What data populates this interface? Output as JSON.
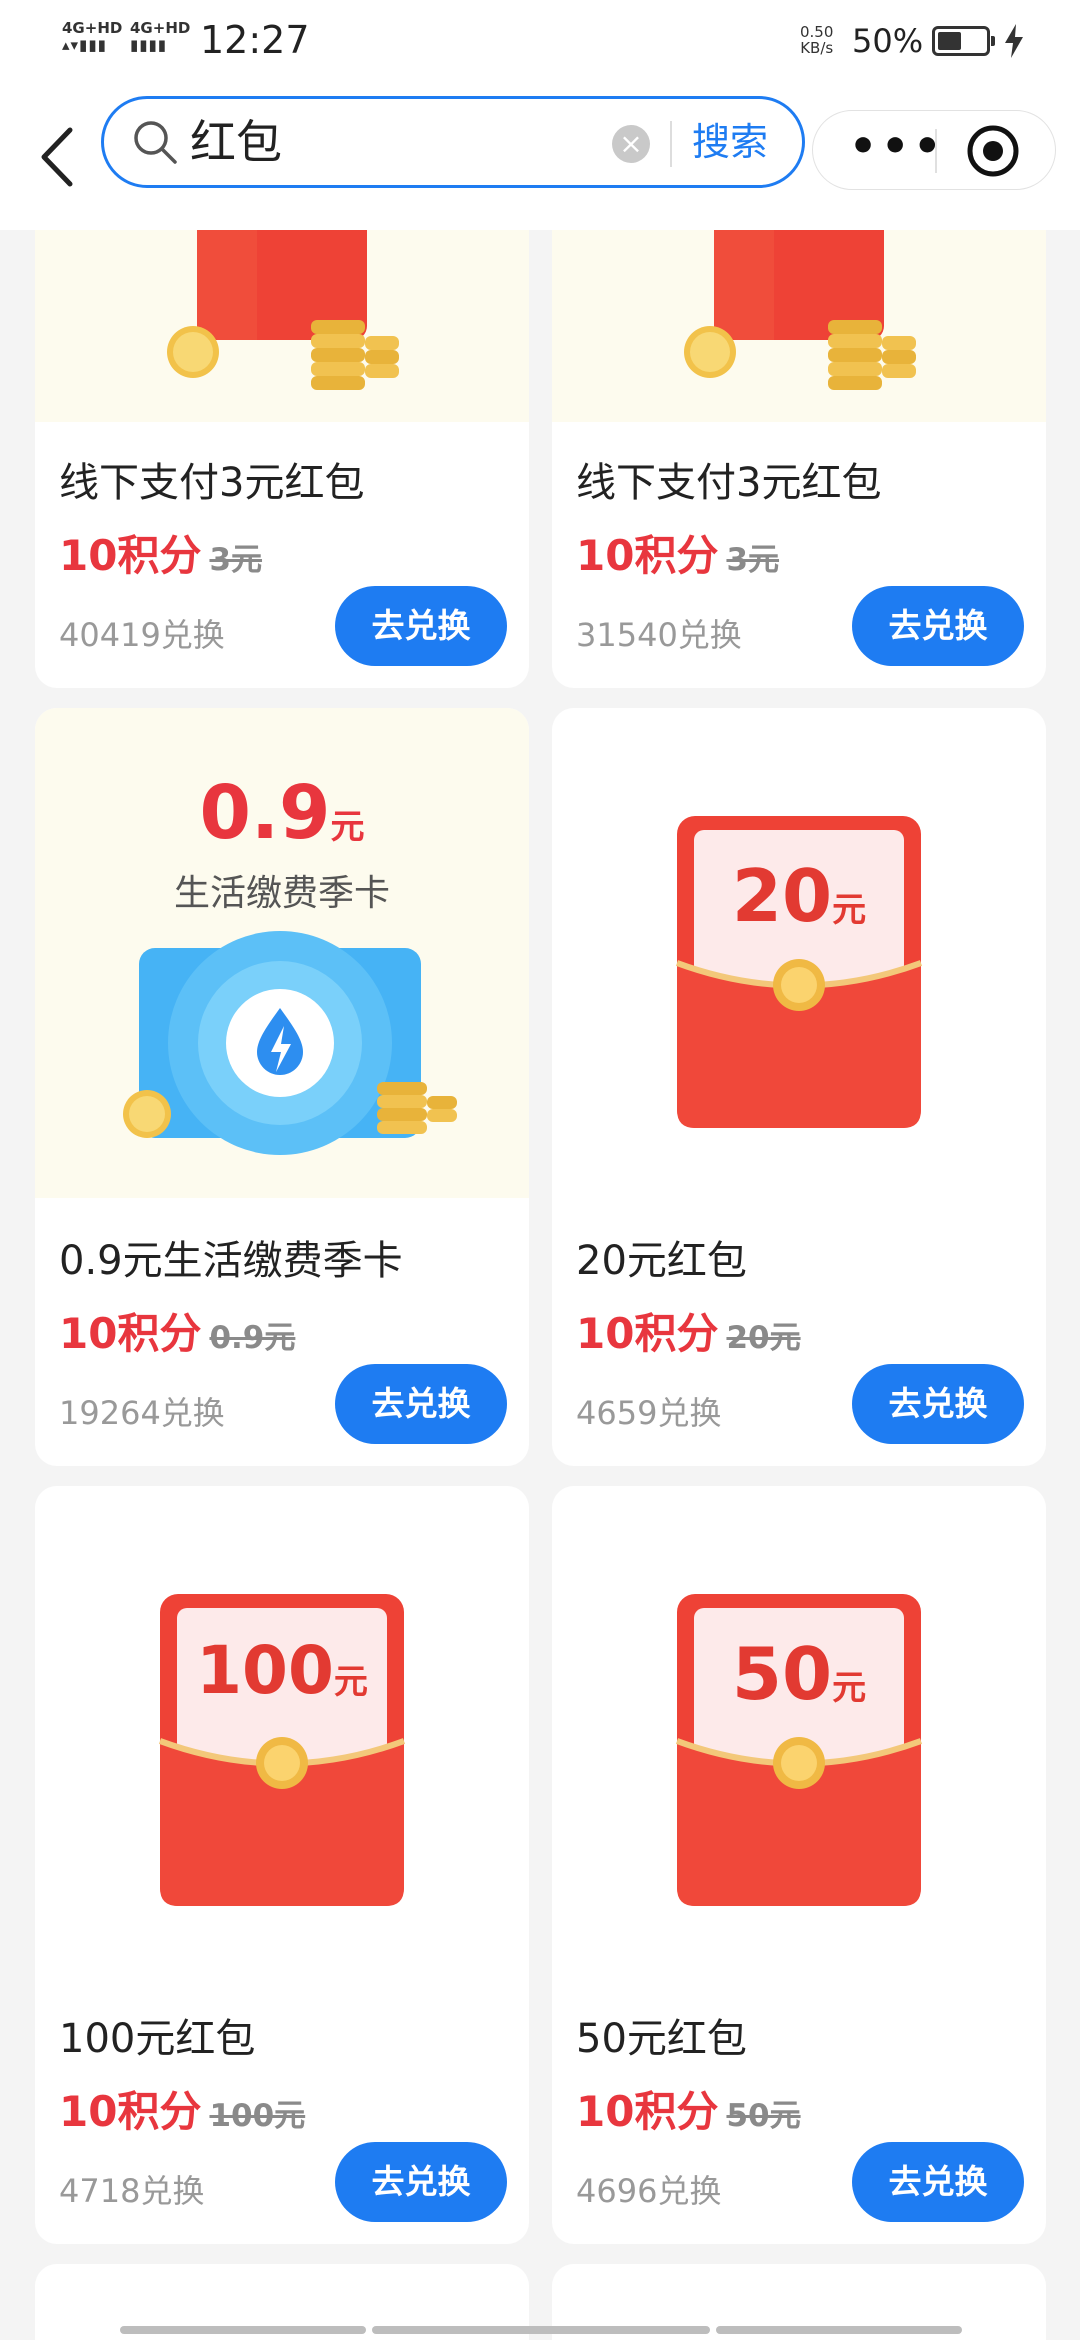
{
  "status": {
    "sig1_label": "4G+HD",
    "sig1_bars": "▴▾▮▮▮",
    "sig2_label": "4G+HD",
    "sig2_bars": "▮▮▮▮",
    "time": "12:27",
    "net_speed": "0.50",
    "net_unit": "KB/s",
    "battery_pct": "50%",
    "battery_level": 0.5
  },
  "header": {
    "search_value": "红包",
    "clear_label": "×",
    "search_button": "搜索",
    "more_label": "•••"
  },
  "products": [
    {
      "name": "线下支付3元红包",
      "points": "10积分",
      "original": "3元",
      "count": "40419兑换",
      "button": "去兑换"
    },
    {
      "name": "线下支付3元红包",
      "points": "10积分",
      "original": "3元",
      "count": "31540兑换",
      "button": "去兑换"
    },
    {
      "name": "0.9元生活缴费季卡",
      "points": "10积分",
      "original": "0.9元",
      "count": "19264兑换",
      "button": "去兑换",
      "art_value": "0.9",
      "art_unit": "元",
      "art_caption": "生活缴费季卡"
    },
    {
      "name": "20元红包",
      "points": "10积分",
      "original": "20元",
      "count": "4659兑换",
      "button": "去兑换",
      "art_value": "20",
      "art_unit": "元"
    },
    {
      "name": "100元红包",
      "points": "10积分",
      "original": "100元",
      "count": "4718兑换",
      "button": "去兑换",
      "art_value": "100",
      "art_unit": "元"
    },
    {
      "name": "50元红包",
      "points": "10积分",
      "original": "50元",
      "count": "4696兑换",
      "button": "去兑换",
      "art_value": "50",
      "art_unit": "元"
    }
  ],
  "colors": {
    "accent_blue": "#1e7cf2",
    "points_red": "#e8363e",
    "envelope_red": "#ee4236",
    "cream_bg": "#fdfbee"
  }
}
